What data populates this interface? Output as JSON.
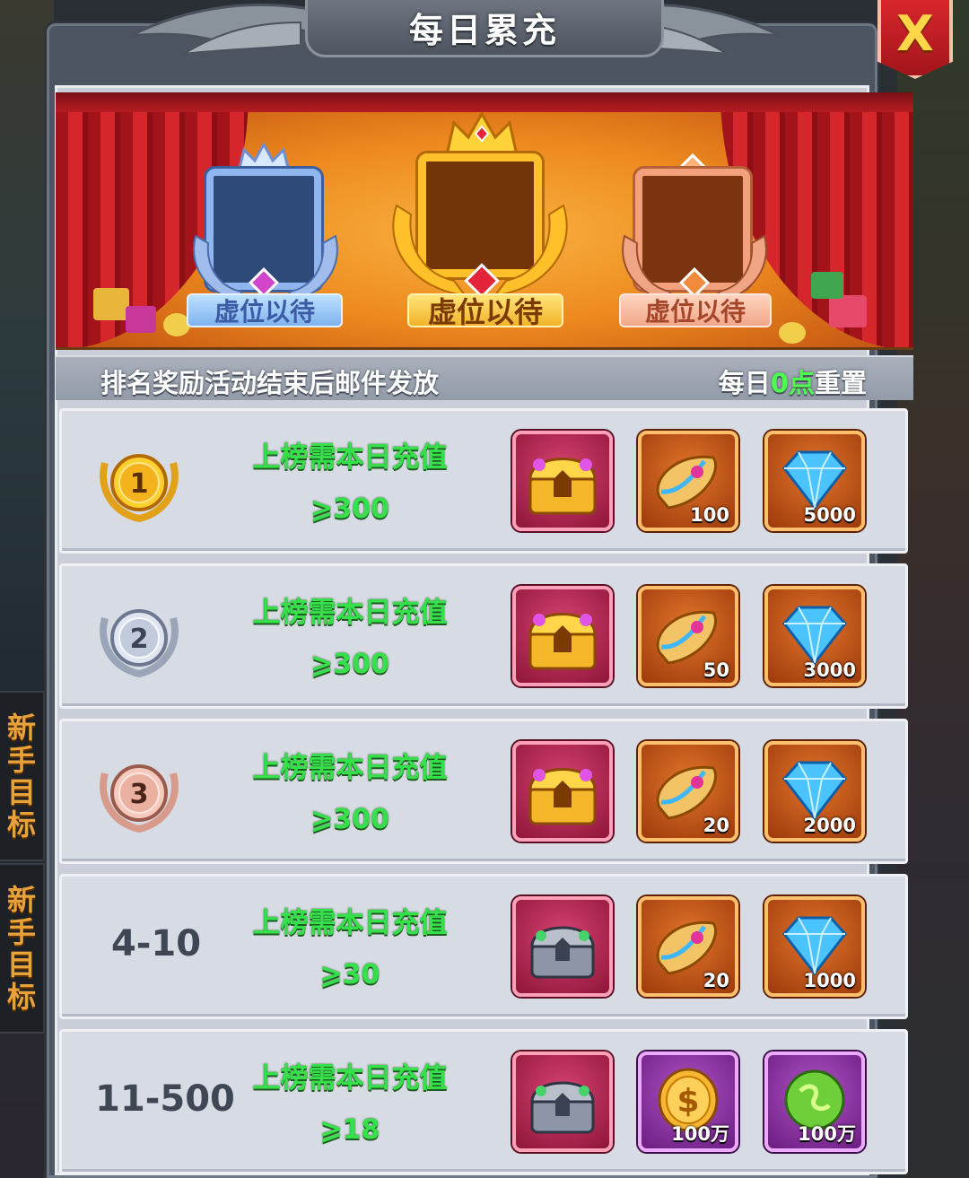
{
  "window": {
    "title": "每日累充",
    "close_label": "X"
  },
  "side_tabs": [
    {
      "label": [
        "新",
        "手",
        "目",
        "标"
      ]
    },
    {
      "label": [
        "新",
        "手",
        "目",
        "标"
      ]
    }
  ],
  "podium": {
    "silver_label": "虚位以待",
    "gold_label": "虚位以待",
    "bronze_label": "虚位以待"
  },
  "info": {
    "notice": "排名奖励活动结束后邮件发放",
    "reset_prefix": "每日",
    "reset_highlight": "0点",
    "reset_suffix": "重置"
  },
  "rows": [
    {
      "rank": "1",
      "rank_style": "gold",
      "requirement_label": "上榜需本日充值",
      "requirement_value": "⩾300",
      "rewards": [
        {
          "icon": "golden-treasure-chest-icon",
          "frame": "red",
          "qty": ""
        },
        {
          "icon": "magic-scroll-icon",
          "frame": "orange",
          "qty": "100"
        },
        {
          "icon": "blue-diamond-icon",
          "frame": "orange",
          "qty": "5000"
        }
      ]
    },
    {
      "rank": "2",
      "rank_style": "silver",
      "requirement_label": "上榜需本日充值",
      "requirement_value": "⩾300",
      "rewards": [
        {
          "icon": "golden-treasure-chest-icon",
          "frame": "red",
          "qty": ""
        },
        {
          "icon": "magic-scroll-icon",
          "frame": "orange",
          "qty": "50"
        },
        {
          "icon": "blue-diamond-icon",
          "frame": "orange",
          "qty": "3000"
        }
      ]
    },
    {
      "rank": "3",
      "rank_style": "bronze",
      "requirement_label": "上榜需本日充值",
      "requirement_value": "⩾300",
      "rewards": [
        {
          "icon": "golden-treasure-chest-icon",
          "frame": "red",
          "qty": ""
        },
        {
          "icon": "magic-scroll-icon",
          "frame": "orange",
          "qty": "20"
        },
        {
          "icon": "blue-diamond-icon",
          "frame": "orange",
          "qty": "2000"
        }
      ]
    },
    {
      "rank": "4-10",
      "rank_style": "text",
      "requirement_label": "上榜需本日充值",
      "requirement_value": "⩾30",
      "rewards": [
        {
          "icon": "silver-treasure-chest-icon",
          "frame": "red",
          "qty": ""
        },
        {
          "icon": "magic-scroll-icon",
          "frame": "orange",
          "qty": "20"
        },
        {
          "icon": "blue-diamond-icon",
          "frame": "orange",
          "qty": "1000"
        }
      ]
    },
    {
      "rank": "11-500",
      "rank_style": "text",
      "requirement_label": "上榜需本日充值",
      "requirement_value": "⩾18",
      "rewards": [
        {
          "icon": "silver-treasure-chest-icon",
          "frame": "red",
          "qty": ""
        },
        {
          "icon": "gold-coin-icon",
          "frame": "purple",
          "qty": "100万"
        },
        {
          "icon": "green-essence-orb-icon",
          "frame": "purple",
          "qty": "100万"
        }
      ]
    }
  ],
  "colors": {
    "requirement_green": "#35e04a",
    "highlight_green": "#4dff4d",
    "close_red": "#d7262c",
    "panel_grey": "#c9ced8"
  }
}
